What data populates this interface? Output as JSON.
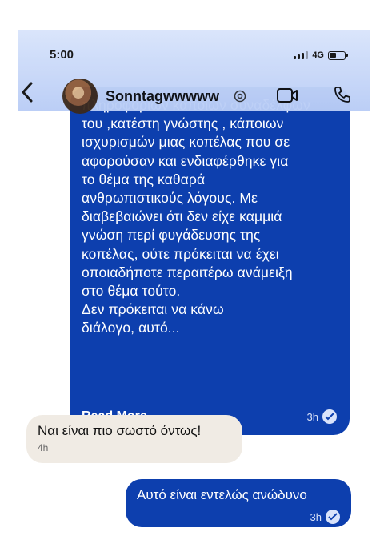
{
  "status_bar": {
    "time": "5:00",
    "network": "4G"
  },
  "header": {
    "contact_name": "Sonntagwwwww"
  },
  "messages": [
    {
      "direction": "outgoing",
      "text": "πληροφοριών κάποιων συναδέλφων\nτου   ,κατέστη γνώστης ,  κάποιων\nισχυρισμών μιας κοπέλας που σε\nαφορούσαν και ενδιαφέρθηκε για\nτο θέμα της καθαρά\nανθρωπιστικούς λόγους. Με\nδιαβεβαιώνει ότι δεν είχε καμμιά\nγνώση περί φυγάδευσης της\nκοπέλας, ούτε πρόκειται να  έχει\nοποιαδήποτε περαιτέρω ανάμειξη\nστο θέμα τούτο.\nΔεν πρόκειται  να κάνω\nδιάλογο, αυτό...",
      "read_more": "Read More",
      "time": "3h"
    },
    {
      "direction": "incoming",
      "text": "Ναι είναι πιο σωστό όντως!",
      "time": "4h"
    },
    {
      "direction": "outgoing",
      "text": "Αυτό είναι εντελώς ανώδυνο",
      "time": "3h"
    }
  ],
  "colors": {
    "outgoing_bubble": "#0d3fae",
    "incoming_bubble": "#f0ebe4",
    "header": "#c8d8f8"
  },
  "icons": [
    "back-icon",
    "verified-icon",
    "video-call-icon",
    "phone-icon",
    "read-check-icon"
  ]
}
